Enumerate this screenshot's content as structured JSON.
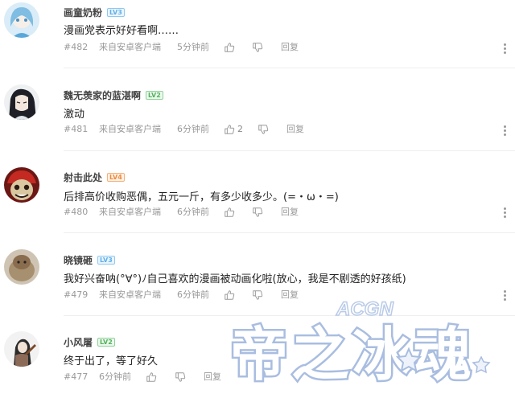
{
  "comments": [
    {
      "username": "画童奶粉",
      "level": "LV3",
      "level_color": "blue",
      "text": "漫画党表示好好看啊……",
      "floor": "#482",
      "source": "来自安卓客户端",
      "time": "5分钟前",
      "likes": "",
      "reply_label": "回复"
    },
    {
      "username": "魏无羡家的蓝湛啊",
      "level": "LV2",
      "level_color": "green",
      "text": "激动",
      "floor": "#481",
      "source": "来自安卓客户端",
      "time": "6分钟前",
      "likes": "2",
      "reply_label": "回复"
    },
    {
      "username": "射击此处",
      "level": "LV4",
      "level_color": "orange",
      "text": "后排高价收购恶偶，五元一斤，有多少收多少。(=・ω・=)",
      "floor": "#480",
      "source": "来自安卓客户端",
      "time": "6分钟前",
      "likes": "",
      "reply_label": "回复"
    },
    {
      "username": "晓镜砸",
      "level": "LV3",
      "level_color": "blue",
      "text": "我好兴奋呐(°∀°)ﾉ自己喜欢的漫画被动画化啦(放心，我是不剧透的好孩纸)",
      "floor": "#479",
      "source": "来自安卓客户端",
      "time": "6分钟前",
      "likes": "",
      "reply_label": "回复"
    },
    {
      "username": "小风屠",
      "level": "LV2",
      "level_color": "green",
      "text": "终于出了，等了好久",
      "floor": "#477",
      "source": "",
      "time": "6分钟前",
      "likes": "",
      "reply_label": "回复"
    }
  ],
  "watermark": {
    "top_text": "ACGN",
    "main_text": "帝之冰魂"
  },
  "colors": {
    "meta_text": "#999999",
    "divider": "#eeeeee",
    "level_blue": "#5fb0e8",
    "level_green": "#52b35c",
    "level_orange": "#ef8a3c"
  },
  "icons": {
    "like": "thumbs-up-icon",
    "dislike": "thumbs-down-icon",
    "more": "more-vertical-icon"
  }
}
